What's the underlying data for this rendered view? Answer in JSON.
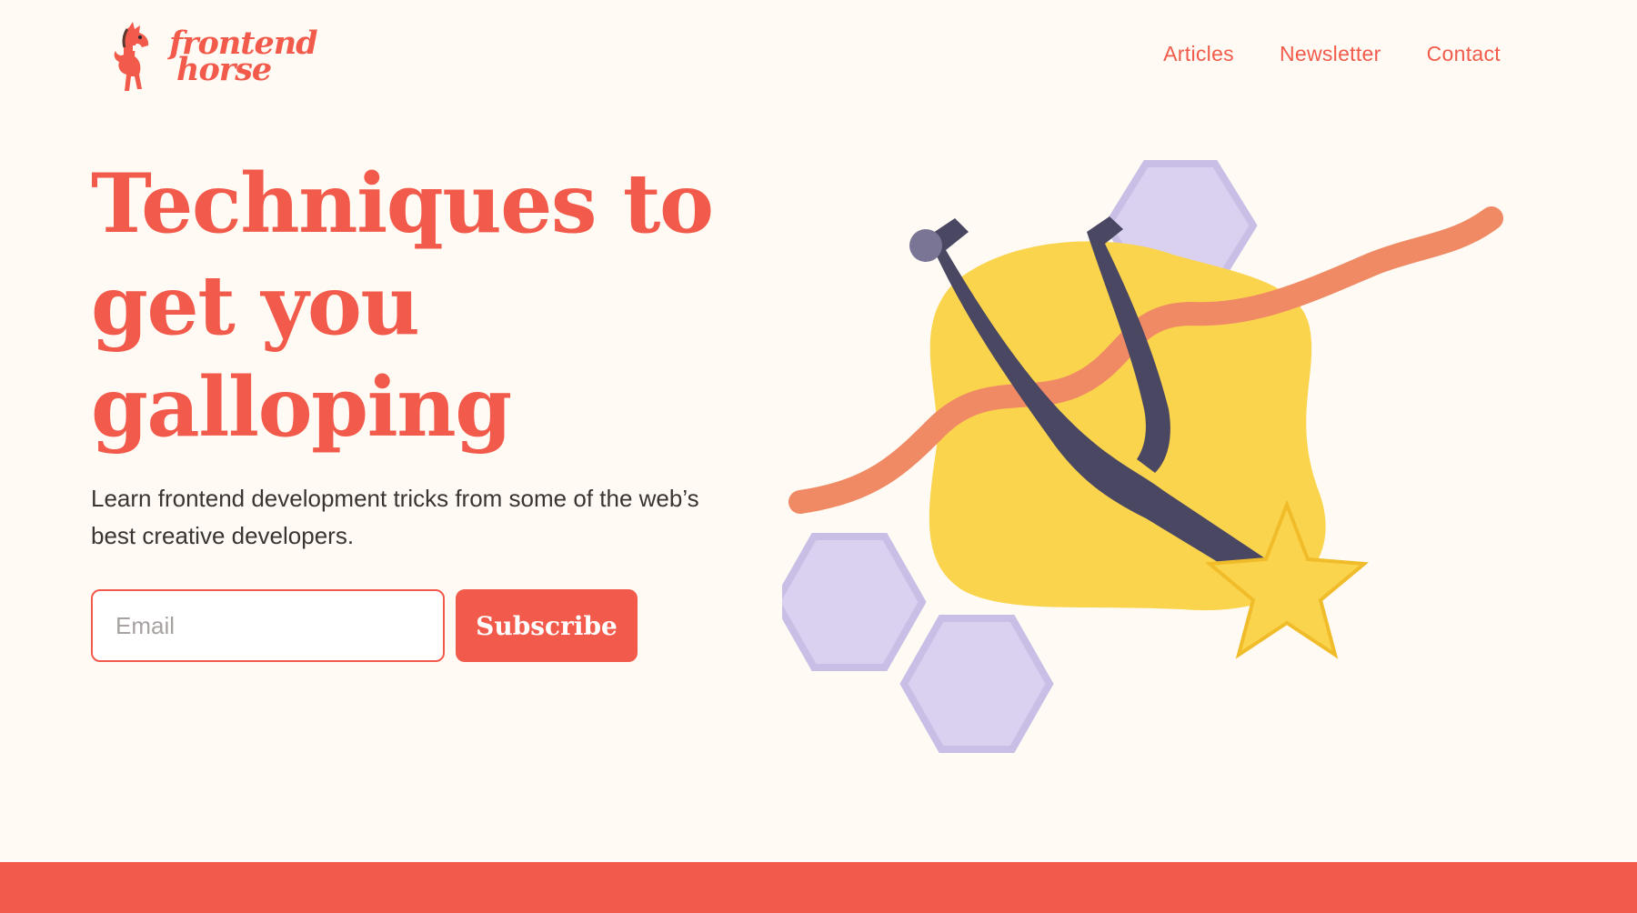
{
  "brand": {
    "name_line1": "frontend",
    "name_line2": "horse",
    "accent_color": "#f25b4b",
    "background_color": "#fffbf4"
  },
  "nav": {
    "items": [
      {
        "label": "Articles"
      },
      {
        "label": "Newsletter"
      },
      {
        "label": "Contact"
      }
    ]
  },
  "hero": {
    "headline": "Techniques to get you galloping",
    "subtext": "Learn frontend development tricks from some of the web’s best creative developers.",
    "email_placeholder": "Email",
    "subscribe_label": "Subscribe"
  },
  "illustration": {
    "icons": [
      "horse-spur-icon",
      "star-icon",
      "hexagon-icon",
      "ribbon-wave-icon",
      "yellow-blob-shape"
    ]
  }
}
